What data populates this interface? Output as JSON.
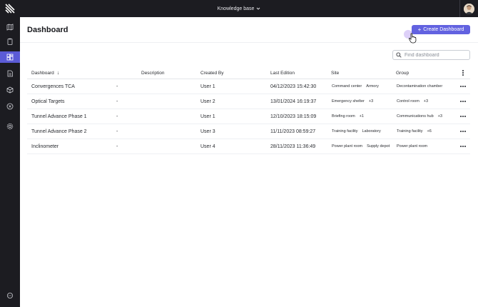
{
  "topbar": {
    "workspace_label": "Knowledge base"
  },
  "sidebar": {
    "items": [
      {
        "name": "map-icon",
        "active": false
      },
      {
        "name": "clipboard-icon",
        "active": false
      },
      {
        "name": "dashboard-icon",
        "active": true
      },
      {
        "name": "document-icon",
        "active": false
      },
      {
        "name": "cube-icon",
        "active": false
      },
      {
        "name": "target-icon",
        "active": false
      },
      {
        "name": "settings-icon",
        "active": false
      }
    ],
    "bottom_item": "chat-icon"
  },
  "page": {
    "title": "Dashboard",
    "create_button": "Create Dashboard",
    "search_placeholder": "Find dashboard"
  },
  "table": {
    "columns": [
      "Dashboard",
      "Description",
      "Created By",
      "Last Edition",
      "Site",
      "Group"
    ],
    "rows": [
      {
        "name": "Convergences TCA",
        "description": "-",
        "created_by": "User 1",
        "last_edition": "04/12/2023 15:42:30",
        "site": [
          "Command center",
          "Armory"
        ],
        "group": [
          "Decontamination chamber"
        ]
      },
      {
        "name": "Optical Targets",
        "description": "-",
        "created_by": "User 2",
        "last_edition": "13/01/2024 16:19:37",
        "site": [
          "Emergency shelter",
          "+3"
        ],
        "group": [
          "Control room",
          "+3"
        ]
      },
      {
        "name": "Tunnel Advance Phase 1",
        "description": "-",
        "created_by": "User 1",
        "last_edition": "12/10/2023 18:15:09",
        "site": [
          "Briefing room",
          "+1"
        ],
        "group": [
          "Communications hub",
          "+3"
        ]
      },
      {
        "name": "Tunnel Advance Phase 2",
        "description": "-",
        "created_by": "User 3",
        "last_edition": "11/11/2023 08:59:27",
        "site": [
          "Training facility",
          "Laboratory"
        ],
        "group": [
          "Training facility",
          "+6"
        ]
      },
      {
        "name": "Inclinometer",
        "description": "-",
        "created_by": "User 4",
        "last_edition": "28/11/2023 11:36:49",
        "site": [
          "Power plant room",
          "Supply depot"
        ],
        "group": [
          "Power plant room"
        ]
      }
    ]
  },
  "colors": {
    "accent": "#6262e0",
    "sidebar_bg": "#1c1c21"
  }
}
